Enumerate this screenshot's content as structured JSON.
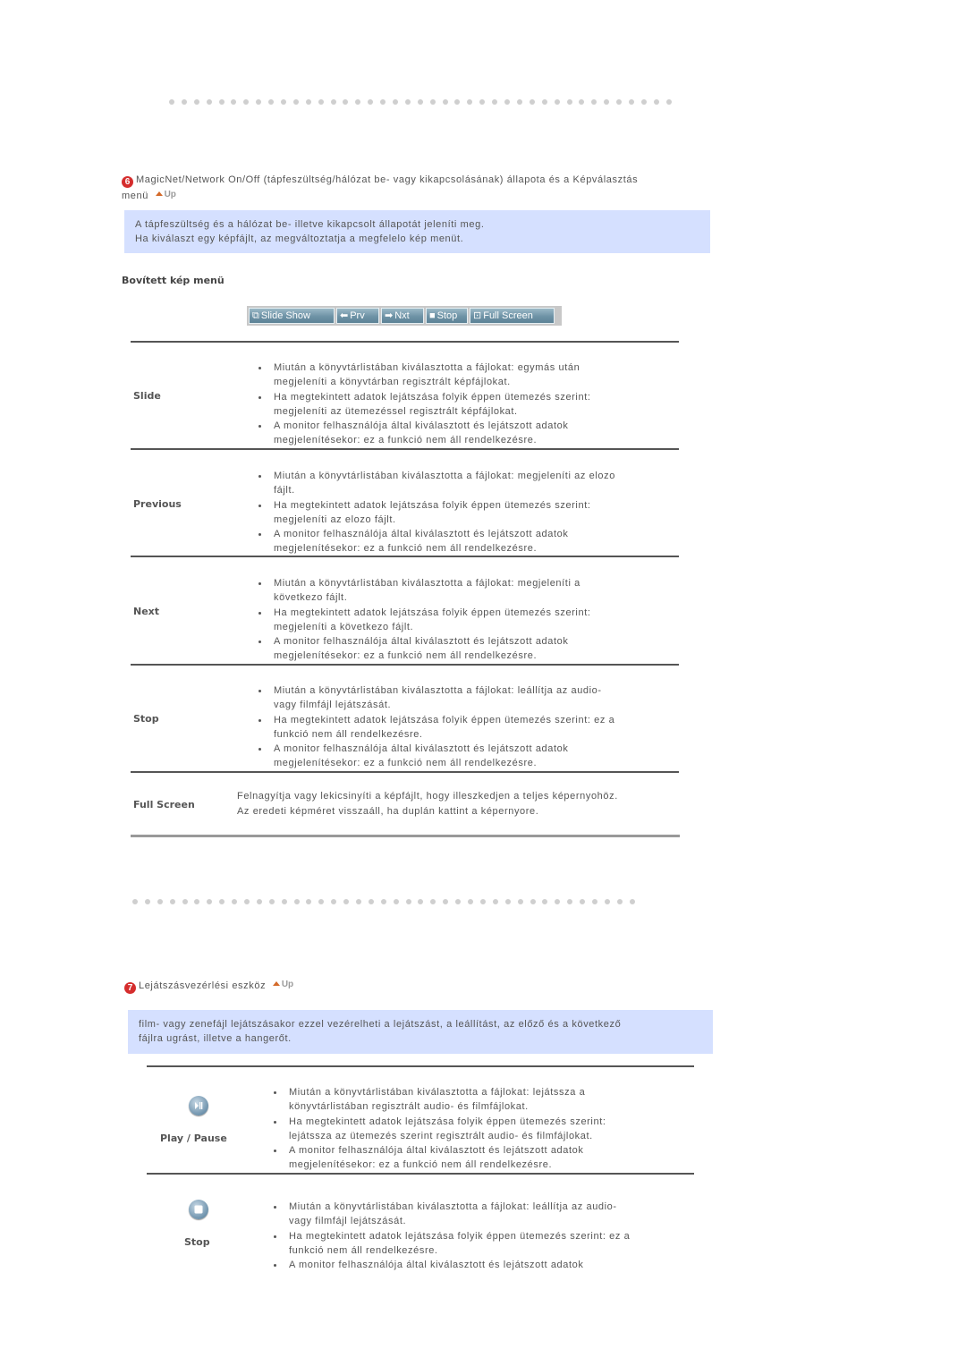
{
  "section6": {
    "number": "6",
    "title_line1": "MagicNet/Network On/Off (tápfeszültség/hálózat be- vagy kikapcsolásának) állapota és a Képválasztás",
    "title_line2": "menü",
    "up_label": "Up",
    "info_line1": "A tápfeszültség és a hálózat be- illetve kikapcsolt állapotát jeleníti meg.",
    "info_line2": "Ha kiválaszt egy képfájlt, az megváltoztatja a megfelelo kép menüt.",
    "subheading": "Bovített kép menü",
    "toolbar": {
      "buttons": [
        {
          "icon": "slideshow-icon",
          "label": "Slide Show"
        },
        {
          "icon": "arrow-left-icon",
          "label": "Prv"
        },
        {
          "icon": "arrow-right-icon",
          "label": "Nxt"
        },
        {
          "icon": "stop-square-icon",
          "label": "Stop"
        },
        {
          "icon": "fullscreen-icon",
          "label": "Full Screen"
        }
      ]
    },
    "rows": [
      {
        "label": "Slide",
        "bullets": [
          [
            "Miután a könyvtárlistában kiválasztotta a fájlokat: egymás után",
            "megjeleníti a könyvtárban regisztrált képfájlokat."
          ],
          [
            "Ha megtekintett adatok lejátszása folyik éppen ütemezés szerint:",
            "megjeleníti az ütemezéssel regisztrált képfájlokat."
          ],
          [
            "A monitor felhasználója által kiválasztott és lejátszott adatok",
            "megjelenítésekor: ez a funkció nem áll rendelkezésre."
          ]
        ]
      },
      {
        "label": "Previous",
        "bullets": [
          [
            "Miután a könyvtárlistában kiválasztotta a fájlokat: megjeleníti az elozo",
            "fájlt."
          ],
          [
            "Ha megtekintett adatok lejátszása folyik éppen ütemezés szerint:",
            "megjeleníti az elozo fájlt."
          ],
          [
            "A monitor felhasználója által kiválasztott és lejátszott adatok",
            "megjelenítésekor: ez a funkció nem áll rendelkezésre."
          ]
        ]
      },
      {
        "label": "Next",
        "bullets": [
          [
            "Miután a könyvtárlistában kiválasztotta a fájlokat: megjeleníti a",
            "következo fájlt."
          ],
          [
            "Ha megtekintett adatok lejátszása folyik éppen ütemezés szerint:",
            "megjeleníti a következo fájlt."
          ],
          [
            "A monitor felhasználója által kiválasztott és lejátszott adatok",
            "megjelenítésekor: ez a funkció nem áll rendelkezésre."
          ]
        ]
      },
      {
        "label": "Stop",
        "bullets": [
          [
            "Miután a könyvtárlistában kiválasztotta a fájlokat: leállítja az audio-",
            "vagy filmfájl lejátszását."
          ],
          [
            "Ha megtekintett adatok lejátszása folyik éppen ütemezés szerint: ez a",
            "funkció nem áll rendelkezésre."
          ],
          [
            "A monitor felhasználója által kiválasztott és lejátszott adatok",
            "megjelenítésekor: ez a funkció nem áll rendelkezésre."
          ]
        ]
      },
      {
        "label": "Full Screen",
        "text_line1": "Felnagyítja vagy lekicsinyíti a képfájlt, hogy illeszkedjen a teljes képernyohöz.",
        "text_line2": "Az eredeti képméret visszaáll, ha duplán kattint a képernyore."
      }
    ]
  },
  "section7": {
    "number": "7",
    "title": "Lejátszásvezérlési eszköz",
    "up_label": "Up",
    "info_line1": "film- vagy zenefájl lejátszásakor ezzel vezérelheti a lejátszást, a leállítást, az előző és a következő",
    "info_line2": "fájlra ugrást, illetve a hangerőt.",
    "rows": [
      {
        "icon": "play-pause-icon",
        "label": "Play / Pause",
        "bullets": [
          [
            "Miután a könyvtárlistában kiválasztotta a fájlokat: lejátssza a",
            "könyvtárlistában regisztrált audio- és filmfájlokat."
          ],
          [
            "Ha megtekintett adatok lejátszása folyik éppen ütemezés szerint:",
            "lejátssza az ütemezés szerint regisztrált audio- és filmfájlokat."
          ],
          [
            "A monitor felhasználója által kiválasztott és lejátszott adatok",
            "megjelenítésekor: ez a funkció nem áll rendelkezésre."
          ]
        ]
      },
      {
        "icon": "stop-icon",
        "label": "Stop",
        "bullets": [
          [
            "Miután a könyvtárlistában kiválasztotta a fájlokat: leállítja az audio-",
            "vagy filmfájl lejátszását."
          ],
          [
            "Ha megtekintett adatok lejátszása folyik éppen ütemezés szerint: ez a",
            "funkció nem áll rendelkezésre."
          ],
          [
            "A monitor felhasználója által kiválasztott és lejátszott adatok"
          ]
        ]
      }
    ]
  }
}
